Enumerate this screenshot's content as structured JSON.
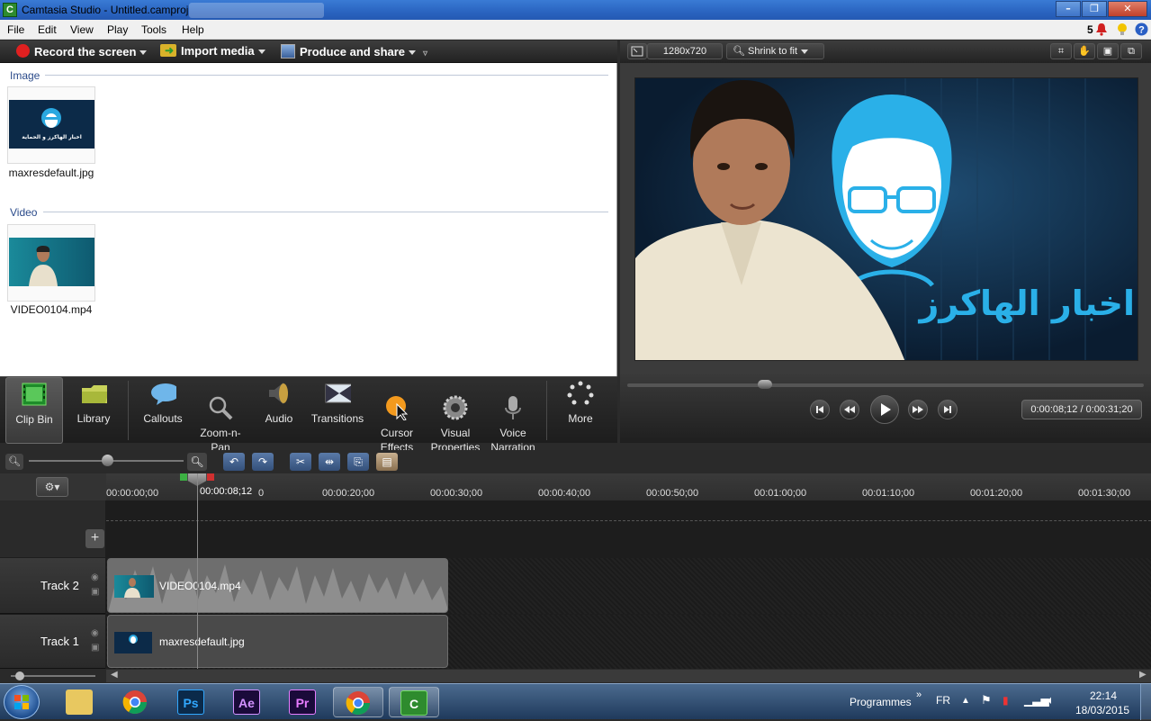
{
  "window": {
    "title": "Camtasia Studio - Untitled.camproj",
    "min": "–",
    "max": "❐",
    "close": "✕"
  },
  "menu": [
    "File",
    "Edit",
    "View",
    "Play",
    "Tools",
    "Help"
  ],
  "status": {
    "notifications": "5"
  },
  "toolbar": {
    "record": "Record the screen",
    "import": "Import media",
    "produce": "Produce and share"
  },
  "bin": {
    "image_section": "Image",
    "image_file": "maxresdefault.jpg",
    "image_caption": "اخبار الهاكرز و الحماية",
    "video_section": "Video",
    "video_file": "VIDEO0104.mp4"
  },
  "tools": [
    {
      "label": "Clip Bin",
      "icon": "film-icon"
    },
    {
      "label": "Library",
      "icon": "folder-icon"
    },
    {
      "label": "Callouts",
      "icon": "speech-bubble-icon"
    },
    {
      "label": "Zoom-n-\nPan",
      "icon": "magnifier-icon"
    },
    {
      "label": "Audio",
      "icon": "speaker-icon"
    },
    {
      "label": "Transitions",
      "icon": "transitions-icon"
    },
    {
      "label": "Cursor\nEffects",
      "icon": "cursor-icon"
    },
    {
      "label": "Visual\nProperties",
      "icon": "gear-icon"
    },
    {
      "label": "Voice\nNarration",
      "icon": "microphone-icon"
    },
    {
      "label": "More",
      "icon": "dots-icon"
    }
  ],
  "preview": {
    "resolution": "1280x720",
    "zoom": "Shrink to fit",
    "overlay_text": "اخبار الهاكرز",
    "time": "0:00:08;12 / 0:00:31;20",
    "progress": 0.26
  },
  "timeline": {
    "playhead": "00:00:08;12",
    "ticks": [
      "00:00:00;00",
      "0",
      "00:00:20;00",
      "00:00:30;00",
      "00:00:40;00",
      "00:00:50;00",
      "00:01:00;00",
      "00:01:10;00",
      "00:01:20;00",
      "00:01:30;00"
    ],
    "tracks": [
      {
        "name": "Track 2",
        "clip": "VIDEO0104.mp4"
      },
      {
        "name": "Track 1",
        "clip": "maxresdefault.jpg"
      }
    ]
  },
  "taskbar": {
    "programmes": "Programmes",
    "lang": "FR",
    "time": "22:14",
    "date": "18/03/2015"
  },
  "colors": {
    "accent": "#3a7bd5",
    "record": "#e02020",
    "track_bg": "#1d1d1d"
  }
}
